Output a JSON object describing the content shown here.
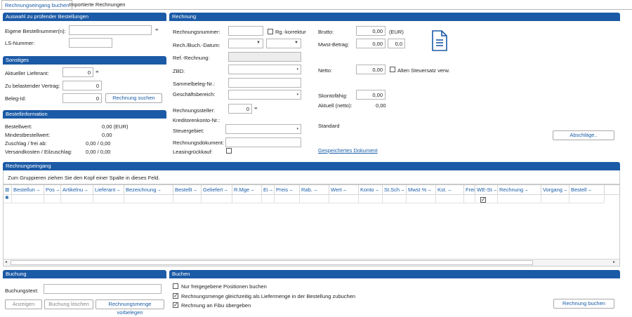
{
  "tabs": [
    "Rechnungseingang buchen",
    "Importierte Rechnungen"
  ],
  "sections": {
    "auswahl": "Auswahl zu prüfender Bestellungen",
    "sonstiges": "Sonstiges",
    "bestellinfo": "Bestellinformation",
    "rechnung": "Rechnung",
    "rechnungseingang": "Rechnungseingang",
    "buchung": "Buchung",
    "buchen": "Buchen"
  },
  "auswahl": {
    "bestellnr_label": "Eigene Bestellnummer(n):",
    "ls_label": "LS-Nummer:"
  },
  "sonstiges": {
    "lieferant_label": "Aktueller Lieferant:",
    "lieferant_value": "0",
    "vertrag_label": "Zu belastender Vertrag:",
    "vertrag_value": "0",
    "belegid_label": "Beleg-Id:",
    "belegid_value": "0",
    "suchen_button": "Rechnung suchen"
  },
  "bestellinfo": {
    "rows": [
      {
        "label": "Bestellwert:",
        "value": "0,00 (EUR)"
      },
      {
        "label": "Mindestbestellwert:",
        "value": "0,00"
      },
      {
        "label": "Zuschlag / frei ab:",
        "value": "0,00 / 0,00"
      },
      {
        "label": "Versandkosten / Eilzuschlag:",
        "value": "0,00 / 0,00"
      }
    ]
  },
  "rechnung": {
    "nummer_label": "Rechnungsnummer:",
    "korrektur_label": "Rg.-korrektur",
    "datum_label": "Rech./Buch.-Datum:",
    "ref_label": "Ref.-Rechnung:",
    "zbd_label": "ZBD:",
    "sammel_label": "Sammelbeleg-Nr.:",
    "geschaeft_label": "Geschäftsbereich:",
    "steller_label": "Rechnungssteller:",
    "steller_value": "0",
    "kreditor_label": "Kreditorenkonto-Nr.:",
    "steuer_label": "Steuergebiet:",
    "dokument_label": "Rechnungsdokument:",
    "leasing_label": "Leasingrückkauf:",
    "brutto_label": "Brutto:",
    "brutto_value": "0,00",
    "currency": "(EUR)",
    "mwst_label": "Mwst-Betrag:",
    "mwst_value": "0,00",
    "mwst_rate": "0,0",
    "netto_label": "Netto:",
    "netto_value": "0,00",
    "alt_steuer_label": "Alten Steuersatz verw.",
    "skonto_label": "Skontofähig:",
    "skonto_value": "0,00",
    "aktuell_label": "Aktuell  (netto):",
    "aktuell_value": "0,00",
    "standard": "Standard",
    "gesp_dok": "Gespeichertes Dokument",
    "abschlaege_button": "Abschläge.."
  },
  "grid": {
    "group_hint": "Zum Gruppieren ziehen Sie den Kopf einer Spalte in dieses Feld.",
    "columns": [
      "Bestellun",
      "Pos",
      "Artikelnu",
      "Lieferant",
      "Bezeichnung",
      "Bestellt",
      "Geliefert",
      "R.Mge",
      "Ei",
      "Preis",
      "Rab.",
      "Wert",
      "Konto",
      "St.Sch",
      "Mwst %",
      "Kst.",
      "Frei",
      "WE-St",
      "Rechnung",
      "Vorgang",
      "Bestell"
    ]
  },
  "buchung": {
    "text_label": "Buchungstext:",
    "anzeigen": "Anzeigen",
    "loeschen": "Buchung löschen",
    "vorbelegen": "Rechnungsmenge vorbelegen"
  },
  "buchen": {
    "opt1": "Nur freigegebene Positionen buchen",
    "opt2": "Rechnungsmenge gleichzeitig als Liefermenge in der Bestellung zubuchen",
    "opt3": "Rechnung an Fibu übergeben",
    "button": "Rechnung buchen"
  }
}
